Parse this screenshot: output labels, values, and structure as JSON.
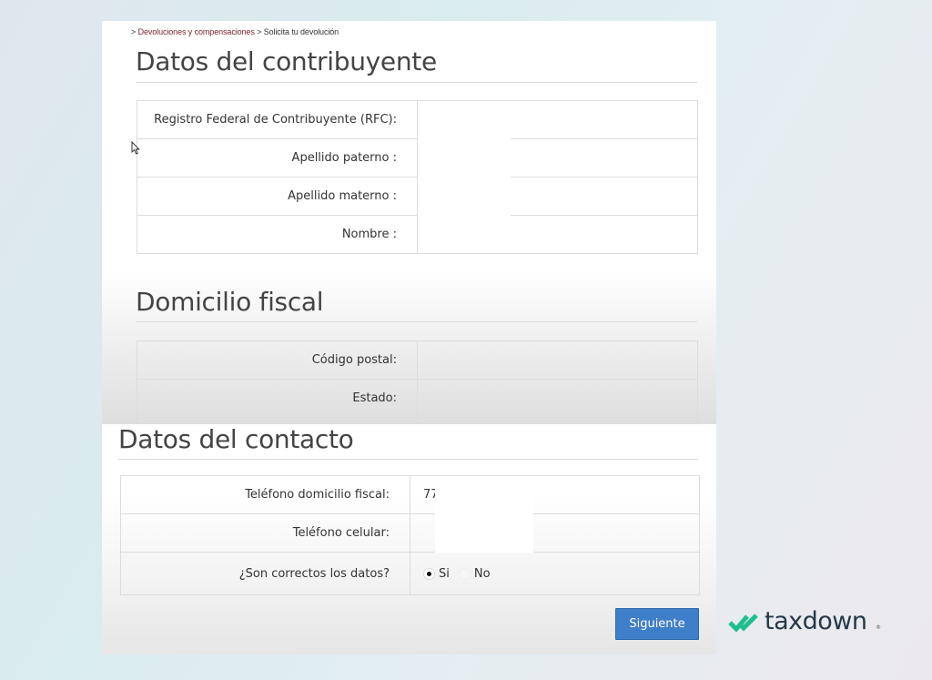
{
  "breadcrumb": {
    "sep1": "> ",
    "link": "Devoluciones y compensaciones",
    "sep2": " > ",
    "current": "Solicita tu devolución"
  },
  "contribuyente": {
    "title": "Datos del contribuyente",
    "rows": [
      {
        "label": "Registro Federal de Contribuyente (RFC):",
        "value": ""
      },
      {
        "label": "Apellido paterno :",
        "value": ""
      },
      {
        "label": "Apellido materno :",
        "value": ""
      },
      {
        "label": "Nombre :",
        "value": ""
      }
    ]
  },
  "domicilio": {
    "title": "Domicilio fiscal",
    "rows": [
      {
        "label": "Código postal:",
        "value": ""
      },
      {
        "label": "Estado:",
        "value": ""
      }
    ]
  },
  "contacto": {
    "title": "Datos del contacto",
    "rows": [
      {
        "label": "Teléfono domicilio fiscal:",
        "value": "77"
      },
      {
        "label": "Teléfono celular:",
        "value": ""
      },
      {
        "label": "¿Son correctos los datos?",
        "value": ""
      }
    ],
    "radio_yes": "Si",
    "radio_no": "No",
    "selected": "Si"
  },
  "actions": {
    "next_label": "Siguiente"
  },
  "brand": {
    "name": "taxdown",
    "reg": "®",
    "icon": "double-check-icon",
    "icon_color": "#1fbf8f"
  },
  "colors": {
    "button": "#3f7ec8",
    "breadcrumb_link": "#7a1f2b"
  }
}
